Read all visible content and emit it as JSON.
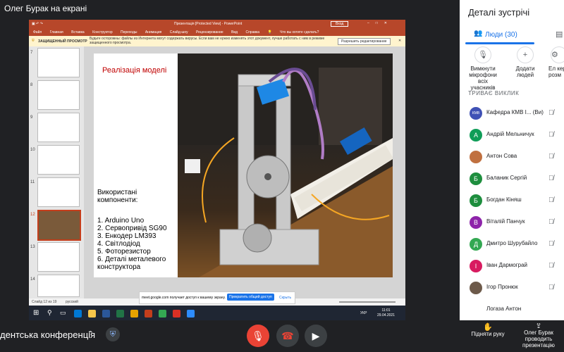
{
  "presenter": {
    "label": "Олег Бурак на екрані"
  },
  "powerpoint": {
    "window_title": "Презентація [Protected View] - PowerPoint",
    "signin_label": "Вход",
    "menu": [
      "Файл",
      "Главная",
      "Вставка",
      "Конструктор",
      "Переходы",
      "Анимация",
      "Слайд-шоу",
      "Рецензирование",
      "Вид",
      "Справка",
      "Что вы хотите сделать?"
    ],
    "protected_view": {
      "label": "ЗАЩИЩЕННЫЙ ПРОСМОТР",
      "message": "Будьте осторожны: файлы из Интернета могут содержать вирусы. Если вам не нужно изменять этот документ, лучше работать с ним в режиме защищенного просмотра.",
      "button": "Разрешить редактирование"
    },
    "thumbnails": [
      "7",
      "8",
      "9",
      "10",
      "11",
      "12",
      "13",
      "14"
    ],
    "selected_thumbnail": "12",
    "slide": {
      "title": "Реалізація моделі",
      "subtitle_line1": "Використані",
      "subtitle_line2": "компоненти:",
      "items": [
        "1. Arduino Uno",
        "2. Сервопривід SG90",
        "3. Енкодер LM393",
        "4. Світлодіод",
        "5. Фоторезистор",
        "6. Деталі металевого",
        "конструктора"
      ]
    },
    "status": {
      "slide_info": "Слайд 12 из 19",
      "language": "русский"
    },
    "share_notice": {
      "text": "meet.google.com получает доступ к вашему экрану.",
      "stop_button": "Прекратить общий доступ",
      "hide_button": "Скрыть"
    },
    "taskbar": {
      "lang": "УКР",
      "time": "11:01",
      "date": "29.04.2021"
    }
  },
  "panel": {
    "title": "Деталі зустрічі",
    "tabs": [
      {
        "label": "Люди (30)",
        "icon": "people-icon"
      },
      {
        "icon": "chat-icon"
      }
    ],
    "actions": [
      {
        "label": "Вимкнути мікрофони всіх учасників",
        "icon": "mic-off-icon"
      },
      {
        "label": "Додати людей",
        "icon": "add-person-icon"
      },
      {
        "label": "Ел керу розм",
        "icon": "settings-icon"
      }
    ],
    "section_label": "ТРИВАЄ ВИКЛИК",
    "participants": [
      {
        "name": "Кафедра КМВ І...",
        "suffix": "(Ви)",
        "initial": "КМВ",
        "color": "#3f51b5"
      },
      {
        "name": "Андрій Мельничук",
        "initial": "А",
        "color": "#0f9d58"
      },
      {
        "name": "Антон Сова",
        "initial": "",
        "color": "#c07040"
      },
      {
        "name": "Баланик Сергій",
        "initial": "Б",
        "color": "#1e8e3e"
      },
      {
        "name": "Богдан Кіняш",
        "initial": "Б",
        "color": "#1e8e3e"
      },
      {
        "name": "Віталій Панчук",
        "initial": "В",
        "color": "#8e24aa"
      },
      {
        "name": "Дмитро Шурубайло",
        "initial": "Д",
        "color": "#33a852"
      },
      {
        "name": "Іван Дармограй",
        "initial": "І",
        "color": "#d81b60"
      },
      {
        "name": "Ігор Пронюк",
        "initial": "",
        "color": "#6d5a4a"
      },
      {
        "name": "Логаза Антон",
        "initial": "",
        "color": "#ffffff"
      }
    ]
  },
  "bottom": {
    "meeting_name": "дентська конференція",
    "raise_hand": "Підняти руку",
    "presenting": "Олег Бурак проводить презентацію"
  },
  "colors": {
    "powerpoint": "#b7472a",
    "accent": "#1a73e8",
    "end_call": "#ea4335",
    "meet_dark": "#202124"
  }
}
